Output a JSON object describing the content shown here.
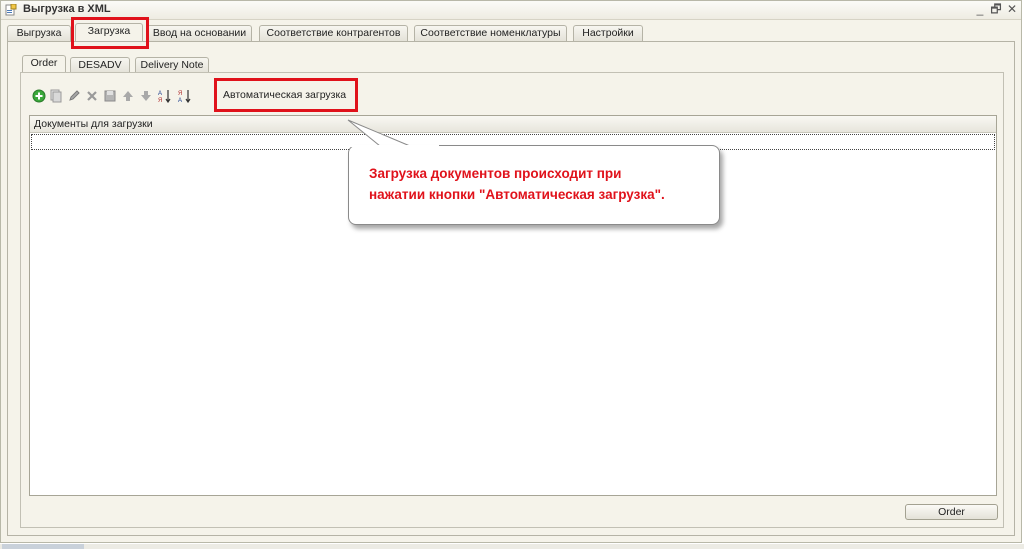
{
  "window": {
    "title": "Выгрузка  в XML",
    "minimize": "_",
    "restore": "🗗",
    "close": "✕"
  },
  "main_tabs": [
    {
      "label": "Выгрузка"
    },
    {
      "label": "Загрузка"
    },
    {
      "label": "Ввод на основании"
    },
    {
      "label": "Соответствие контрагентов"
    },
    {
      "label": "Соответствие номенклатуры"
    },
    {
      "label": "Настройки"
    }
  ],
  "sub_tabs": [
    {
      "label": "Order"
    },
    {
      "label": "DESADV"
    },
    {
      "label": "Delivery Note"
    }
  ],
  "toolbar": {
    "icons": [
      "add-icon",
      "copy-icon",
      "edit-icon",
      "delete-icon",
      "save-icon",
      "move-up-icon",
      "move-down-icon",
      "sort-asc-icon",
      "sort-desc-icon"
    ],
    "auto_load_label": "Автоматическая загрузка"
  },
  "table": {
    "header": "Документы для загрузки"
  },
  "callout": {
    "line1": "Загрузка документов происходит при",
    "line2": "нажатии кнопки \"Автоматическая загрузка\"."
  },
  "footer": {
    "order_button": "Order"
  },
  "colors": {
    "highlight": "#e0121b",
    "callout_text": "#e0121b",
    "panel_bg": "#f5f3ea"
  }
}
